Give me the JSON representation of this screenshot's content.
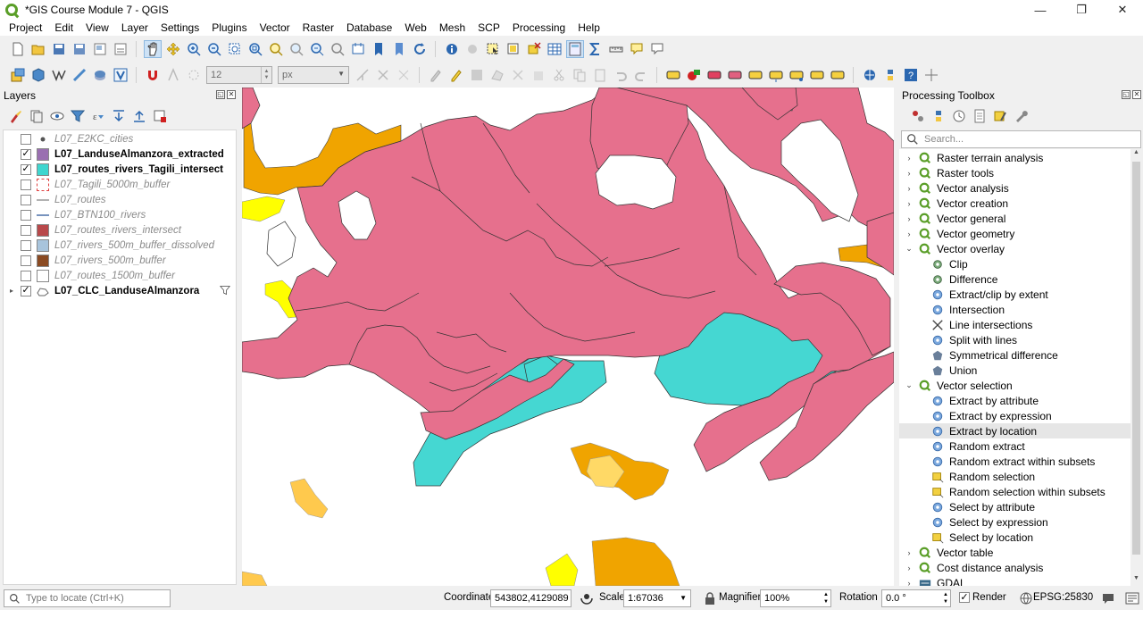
{
  "window": {
    "title": "*GIS Course Module 7 - QGIS",
    "minimize": "—",
    "restore": "❐",
    "close": "✕"
  },
  "menu": [
    "Project",
    "Edit",
    "View",
    "Layer",
    "Settings",
    "Plugins",
    "Vector",
    "Raster",
    "Database",
    "Web",
    "Mesh",
    "SCP",
    "Processing",
    "Help"
  ],
  "toolbar2": {
    "size_value": "12",
    "unit_value": "px"
  },
  "layers_panel": {
    "title": "Layers",
    "layers": [
      {
        "name": "L07_E2KC_cities",
        "checked": false,
        "style": "dim",
        "swatch": "point"
      },
      {
        "name": "L07_LanduseAlmanzora_extracted",
        "checked": true,
        "style": "bold",
        "swatch": "#9a6fb1"
      },
      {
        "name": "L07_routes_rivers_Tagili_intersect",
        "checked": true,
        "style": "bold",
        "swatch": "#3fd6cf"
      },
      {
        "name": "L07_Tagili_5000m_buffer",
        "checked": false,
        "style": "dim",
        "swatch": "dashed-red"
      },
      {
        "name": "L07_routes",
        "checked": false,
        "style": "dim",
        "swatch": "line-grey"
      },
      {
        "name": "L07_BTN100_rivers",
        "checked": false,
        "style": "dim",
        "swatch": "line-blue"
      },
      {
        "name": "L07_routes_rivers_intersect",
        "checked": false,
        "style": "dim",
        "swatch": "#b8484a"
      },
      {
        "name": "L07_rivers_500m_buffer_dissolved",
        "checked": false,
        "style": "dim",
        "swatch": "#a8c4dc"
      },
      {
        "name": "L07_rivers_500m_buffer",
        "checked": false,
        "style": "dim",
        "swatch": "#8a4a22"
      },
      {
        "name": "L07_routes_1500m_buffer",
        "checked": false,
        "style": "dim",
        "swatch": "#ffffff"
      },
      {
        "name": "L07_CLC_LanduseAlmanzora",
        "checked": true,
        "style": "bold",
        "swatch": "group",
        "expander": "▸"
      }
    ]
  },
  "processing_panel": {
    "title": "Processing Toolbox",
    "search_placeholder": "Search...",
    "tree": [
      {
        "label": "Raster terrain analysis",
        "level": 0,
        "arrow": "›",
        "icon": "qgis"
      },
      {
        "label": "Raster tools",
        "level": 0,
        "arrow": "›",
        "icon": "qgis"
      },
      {
        "label": "Vector analysis",
        "level": 0,
        "arrow": "›",
        "icon": "qgis"
      },
      {
        "label": "Vector creation",
        "level": 0,
        "arrow": "›",
        "icon": "qgis"
      },
      {
        "label": "Vector general",
        "level": 0,
        "arrow": "›",
        "icon": "qgis"
      },
      {
        "label": "Vector geometry",
        "level": 0,
        "arrow": "›",
        "icon": "qgis"
      },
      {
        "label": "Vector overlay",
        "level": 0,
        "arrow": "⌄",
        "icon": "qgis"
      },
      {
        "label": "Clip",
        "level": 1,
        "icon": "gear-green"
      },
      {
        "label": "Difference",
        "level": 1,
        "icon": "gear-green"
      },
      {
        "label": "Extract/clip by extent",
        "level": 1,
        "icon": "gear-blue"
      },
      {
        "label": "Intersection",
        "level": 1,
        "icon": "gear-blue"
      },
      {
        "label": "Line intersections",
        "level": 1,
        "icon": "lines"
      },
      {
        "label": "Split with lines",
        "level": 1,
        "icon": "gear-blue"
      },
      {
        "label": "Symmetrical difference",
        "level": 1,
        "icon": "poly"
      },
      {
        "label": "Union",
        "level": 1,
        "icon": "poly"
      },
      {
        "label": "Vector selection",
        "level": 0,
        "arrow": "⌄",
        "icon": "qgis"
      },
      {
        "label": "Extract by attribute",
        "level": 1,
        "icon": "gear-blue"
      },
      {
        "label": "Extract by expression",
        "level": 1,
        "icon": "gear-blue"
      },
      {
        "label": "Extract by location",
        "level": 1,
        "icon": "gear-blue",
        "selected": true
      },
      {
        "label": "Random extract",
        "level": 1,
        "icon": "gear-blue"
      },
      {
        "label": "Random extract within subsets",
        "level": 1,
        "icon": "gear-blue"
      },
      {
        "label": "Random selection",
        "level": 1,
        "icon": "select"
      },
      {
        "label": "Random selection within subsets",
        "level": 1,
        "icon": "select"
      },
      {
        "label": "Select by attribute",
        "level": 1,
        "icon": "gear-blue"
      },
      {
        "label": "Select by expression",
        "level": 1,
        "icon": "gear-blue"
      },
      {
        "label": "Select by location",
        "level": 1,
        "icon": "select"
      },
      {
        "label": "Vector table",
        "level": 0,
        "arrow": "›",
        "icon": "qgis"
      },
      {
        "label": "Cost distance analysis",
        "level": 0,
        "arrow": "›",
        "icon": "qgis"
      },
      {
        "label": "GDAL",
        "level": 0,
        "arrow": "›",
        "icon": "gdal"
      }
    ]
  },
  "statusbar": {
    "locate_placeholder": "Type to locate (Ctrl+K)",
    "coordinate_label": "Coordinate",
    "coordinate_value": "543802,4129089",
    "scale_label": "Scale",
    "scale_value": "1:67036",
    "magnifier_label": "Magnifier",
    "magnifier_value": "100%",
    "rotation_label": "Rotation",
    "rotation_value": "0.0 °",
    "render_label": "Render",
    "render_checked": true,
    "crs_label": "EPSG:25830"
  },
  "colors": {
    "landuse_pink": "#e6708d",
    "intersect_cyan": "#45d7d2",
    "orange": "#f0a400",
    "light_orange": "#ffc94d",
    "yellow": "#ffff00"
  }
}
